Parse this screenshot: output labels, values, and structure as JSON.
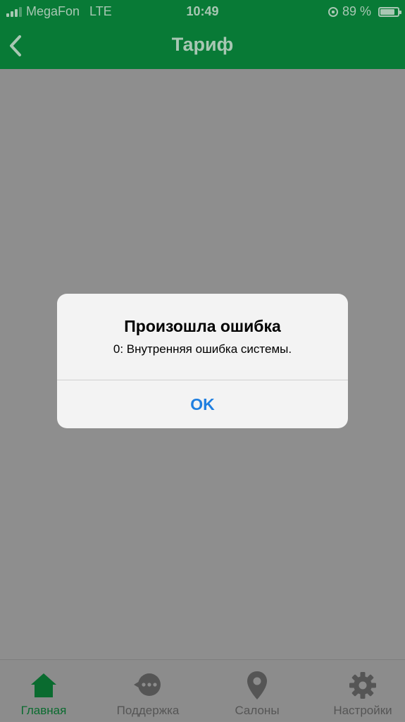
{
  "status_bar": {
    "carrier": "MegaFon",
    "network": "LTE",
    "time": "10:49",
    "battery": "89 %",
    "battery_level": 0.89
  },
  "header": {
    "title": "Тариф",
    "back_icon": "chevron-left-icon",
    "color": "#087a36"
  },
  "alert": {
    "title": "Произошла ошибка",
    "message": "0: Внутренняя ошибка системы.",
    "ok_label": "OK",
    "button_color": "#1f7fe0"
  },
  "tab_bar": {
    "items": [
      {
        "label": "Главная",
        "icon": "home-icon",
        "active": true
      },
      {
        "label": "Поддержка",
        "icon": "chat-icon",
        "active": false
      },
      {
        "label": "Салоны",
        "icon": "map-pin-icon",
        "active": false
      },
      {
        "label": "Настройки",
        "icon": "gear-icon",
        "active": false
      }
    ],
    "active_color": "#0a6b2f"
  }
}
